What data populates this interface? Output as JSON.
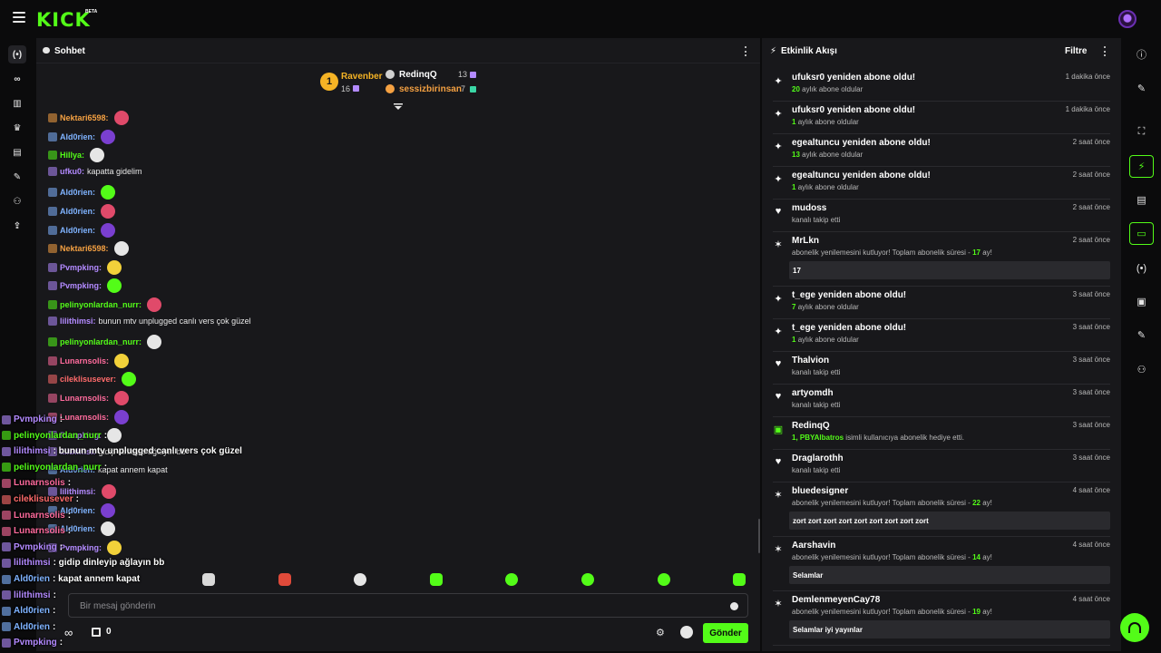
{
  "brand": {
    "logo": "KICK",
    "beta": "BETA",
    "accent": "#53fc18"
  },
  "left_rail": [
    "live-icon",
    "link-icon",
    "chart-icon",
    "trophy-icon",
    "media-icon",
    "wrench-icon",
    "users-icon",
    "upload-icon"
  ],
  "chat": {
    "title": "Sohbet",
    "top_gifters": [
      {
        "rank": "1",
        "name": "Ravenber",
        "count": "16",
        "color": "#f5b325"
      },
      {
        "name": "RedinqQ",
        "count": "13",
        "color": "#ffffff"
      },
      {
        "name": "sessizbirinsan",
        "count": "7",
        "color": "#f5a142"
      }
    ],
    "messages": [
      {
        "user": "Nektari6598:",
        "color": "#f5a142",
        "text": ""
      },
      {
        "user": "Ald0rien:",
        "color": "#7fb3ff",
        "text": ""
      },
      {
        "user": "Hillya:",
        "color": "#53fc18",
        "text": ""
      },
      {
        "user": "ufku0:",
        "color": "#b38aff",
        "text": "kapatta gidelim"
      },
      {
        "user": "Ald0rien:",
        "color": "#7fb3ff",
        "text": ""
      },
      {
        "user": "Ald0rien:",
        "color": "#7fb3ff",
        "text": ""
      },
      {
        "user": "Ald0rien:",
        "color": "#7fb3ff",
        "text": ""
      },
      {
        "user": "Nektari6598:",
        "color": "#f5a142",
        "text": ""
      },
      {
        "user": "Pvmpking:",
        "color": "#b38aff",
        "text": ""
      },
      {
        "user": "Pvmpking:",
        "color": "#b38aff",
        "text": ""
      },
      {
        "user": "pelinyonlardan_nurr:",
        "color": "#53fc18",
        "text": ""
      },
      {
        "user": "lilithimsi:",
        "color": "#b38aff",
        "text": "bunun mtv unplugged canlı vers çok güzel"
      },
      {
        "user": "pelinyonlardan_nurr:",
        "color": "#53fc18",
        "text": ""
      },
      {
        "user": "Lunarnsolis:",
        "color": "#ff6b9d",
        "text": ""
      },
      {
        "user": "cileklisusever:",
        "color": "#ff6b6b",
        "text": ""
      },
      {
        "user": "Lunarnsolis:",
        "color": "#ff6b9d",
        "text": ""
      },
      {
        "user": "Lunarnsolis:",
        "color": "#ff6b9d",
        "text": ""
      },
      {
        "user": "Pvmpking:",
        "color": "#b38aff",
        "text": ""
      },
      {
        "user": "lilithimsi:",
        "color": "#b38aff",
        "text": "gidip dinleyip ağlayın bb"
      },
      {
        "user": "Ald0rien:",
        "color": "#7fb3ff",
        "text": "kapat annem kapat"
      },
      {
        "user": "lilithimsi:",
        "color": "#b38aff",
        "text": ""
      },
      {
        "user": "Ald0rien:",
        "color": "#7fb3ff",
        "text": ""
      },
      {
        "user": "Ald0rien:",
        "color": "#7fb3ff",
        "text": ""
      },
      {
        "user": "Pvmpking:",
        "color": "#b38aff",
        "text": ""
      }
    ],
    "input_placeholder": "Bir mesaj gönderin",
    "points": "∞",
    "gift_count": "0",
    "send_label": "Gönder"
  },
  "overlay_chat": [
    {
      "user": "Pvmpking",
      "color": "#b38aff",
      "text": ":"
    },
    {
      "user": "pelinyonlardan_nurr",
      "color": "#53fc18",
      "text": ":"
    },
    {
      "user": "lilithimsi",
      "color": "#b38aff",
      "text": ": bunun mtv unplugged canlı vers çok güzel"
    },
    {
      "user": "pelinyonlardan_nurr",
      "color": "#53fc18",
      "text": ":"
    },
    {
      "user": "Lunarnsolis",
      "color": "#ff6b9d",
      "text": ":"
    },
    {
      "user": "cileklisusever",
      "color": "#ff6b6b",
      "text": ":"
    },
    {
      "user": "Lunarnsolis",
      "color": "#ff6b9d",
      "text": ":"
    },
    {
      "user": "Lunarnsolis",
      "color": "#ff6b9d",
      "text": ":"
    },
    {
      "user": "Pvmpking",
      "color": "#b38aff",
      "text": ":"
    },
    {
      "user": "lilithimsi",
      "color": "#b38aff",
      "text": ": gidip dinleyip ağlayın bb"
    },
    {
      "user": "Ald0rien",
      "color": "#7fb3ff",
      "text": ": kapat annem kapat"
    },
    {
      "user": "lilithimsi",
      "color": "#b38aff",
      "text": ":"
    },
    {
      "user": "Ald0rien",
      "color": "#7fb3ff",
      "text": ":"
    },
    {
      "user": "Ald0rien",
      "color": "#7fb3ff",
      "text": ":"
    },
    {
      "user": "Pvmpking",
      "color": "#b38aff",
      "text": ":"
    }
  ],
  "activity": {
    "title": "Etkinlik Akışı",
    "filter_label": "Filtre",
    "items": [
      {
        "icon": "sparkle-icon",
        "title": "ufuksr0 yeniden abone oldu!",
        "time": "1 dakika önce",
        "num": "20",
        "sub": "aylık abone oldular",
        "box": ""
      },
      {
        "icon": "sparkle-icon",
        "title": "ufuksr0 yeniden abone oldu!",
        "time": "1 dakika önce",
        "num": "1",
        "sub": "aylık abone oldular",
        "box": ""
      },
      {
        "icon": "sparkle-icon",
        "title": "egealtuncu yeniden abone oldu!",
        "time": "2 saat önce",
        "num": "13",
        "sub": "aylık abone oldular",
        "box": ""
      },
      {
        "icon": "sparkle-icon",
        "title": "egealtuncu yeniden abone oldu!",
        "time": "2 saat önce",
        "num": "1",
        "sub": "aylık abone oldular",
        "box": ""
      },
      {
        "icon": "heart-icon",
        "title": "mudoss",
        "time": "2 saat önce",
        "num": "",
        "sub": "kanalı takip etti",
        "box": ""
      },
      {
        "icon": "party-icon",
        "title": "MrLkn",
        "time": "2 saat önce",
        "num": "",
        "sub": "abonelik yenilemesini kutluyor! Toplam abonelik süresi -",
        "num2": "17",
        "sub2": "ay!",
        "box": "17"
      },
      {
        "icon": "sparkle-icon",
        "title": "t_ege yeniden abone oldu!",
        "time": "3 saat önce",
        "num": "7",
        "sub": "aylık abone oldular",
        "box": ""
      },
      {
        "icon": "sparkle-icon",
        "title": "t_ege yeniden abone oldu!",
        "time": "3 saat önce",
        "num": "1",
        "sub": "aylık abone oldular",
        "box": ""
      },
      {
        "icon": "heart-icon",
        "title": "Thalvion",
        "time": "3 saat önce",
        "num": "",
        "sub": "kanalı takip etti",
        "box": ""
      },
      {
        "icon": "heart-icon",
        "title": "artyomdh",
        "time": "3 saat önce",
        "num": "",
        "sub": "kanalı takip etti",
        "box": ""
      },
      {
        "icon": "gift-icon",
        "title": "RedinqQ",
        "time": "3 saat önce",
        "num": "1, PBYAlbatros",
        "sub": "isimli kullanıcıya abonelik hediye etti.",
        "box": ""
      },
      {
        "icon": "heart-icon",
        "title": "Draglarothh",
        "time": "3 saat önce",
        "num": "",
        "sub": "kanalı takip etti",
        "box": ""
      },
      {
        "icon": "party-icon",
        "title": "bluedesigner",
        "time": "4 saat önce",
        "num": "",
        "sub": "abonelik yenilemesini kutluyor! Toplam abonelik süresi -",
        "num2": "22",
        "sub2": "ay!",
        "box": "zort zort zort zort zort zort zort zort zort"
      },
      {
        "icon": "party-icon",
        "title": "Aarshavin",
        "time": "4 saat önce",
        "num": "",
        "sub": "abonelik yenilemesini kutluyor! Toplam abonelik süresi -",
        "num2": "14",
        "sub2": "ay!",
        "box": "Selamlar"
      },
      {
        "icon": "party-icon",
        "title": "DemlenmeyenCay78",
        "time": "4 saat önce",
        "num": "",
        "sub": "abonelik yenilemesini kutluyor! Toplam abonelik süresi -",
        "num2": "19",
        "sub2": "ay!",
        "box": "Selamlar iyi yayınlar"
      }
    ]
  },
  "right_rail": [
    "info-icon",
    "edit-icon",
    "fullscreen-icon",
    "bolt-icon",
    "notes-icon",
    "chat-icon",
    "broadcast-icon",
    "mod-icon",
    "wrench-icon",
    "users-icon"
  ]
}
